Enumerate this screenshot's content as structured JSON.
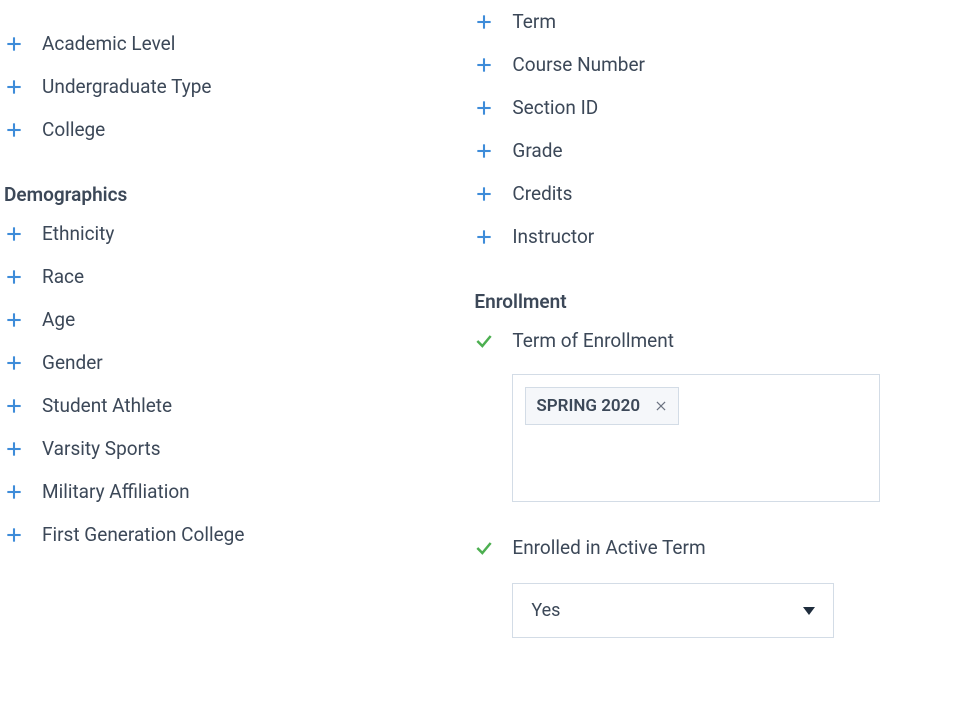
{
  "left": {
    "initial_items": [
      {
        "label": "Academic Level"
      },
      {
        "label": "Undergraduate Type"
      },
      {
        "label": "College"
      }
    ],
    "demographics_header": "Demographics",
    "demographics_items": [
      {
        "label": "Ethnicity"
      },
      {
        "label": "Race"
      },
      {
        "label": "Age"
      },
      {
        "label": "Gender"
      },
      {
        "label": "Student Athlete"
      },
      {
        "label": "Varsity Sports"
      },
      {
        "label": "Military Affiliation"
      },
      {
        "label": "First Generation College"
      }
    ]
  },
  "right": {
    "course_items": [
      {
        "label": "Term"
      },
      {
        "label": "Course Number"
      },
      {
        "label": "Section ID"
      },
      {
        "label": "Grade"
      },
      {
        "label": "Credits"
      },
      {
        "label": "Instructor"
      }
    ],
    "enrollment_header": "Enrollment",
    "term_of_enrollment_label": "Term of Enrollment",
    "term_chip": "SPRING 2020",
    "enrolled_active_label": "Enrolled in Active Term",
    "enrolled_active_value": "Yes"
  }
}
